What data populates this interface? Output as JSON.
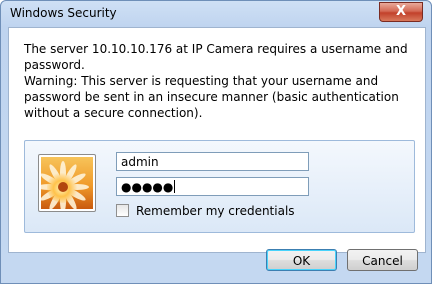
{
  "window": {
    "title": "Windows Security",
    "close_label": "X"
  },
  "dialog": {
    "message": "The server 10.10.10.176 at IP Camera requires a username and password.",
    "warning": "Warning: This server is requesting that your username and password be sent in an insecure manner (basic authentication without a secure connection).",
    "username_value": "admin",
    "password_mask": "●●●●●",
    "remember_label": "Remember my credentials",
    "remember_checked": false
  },
  "buttons": {
    "ok_label": "OK",
    "cancel_label": "Cancel"
  },
  "icons": {
    "user_tile": "user-tile-flower-icon",
    "close": "close-icon",
    "checkbox": "checkbox-icon"
  },
  "colors": {
    "title_bar": "#c4d8f1",
    "close_button": "#c2412b",
    "focus_border": "#3c7fb1"
  }
}
